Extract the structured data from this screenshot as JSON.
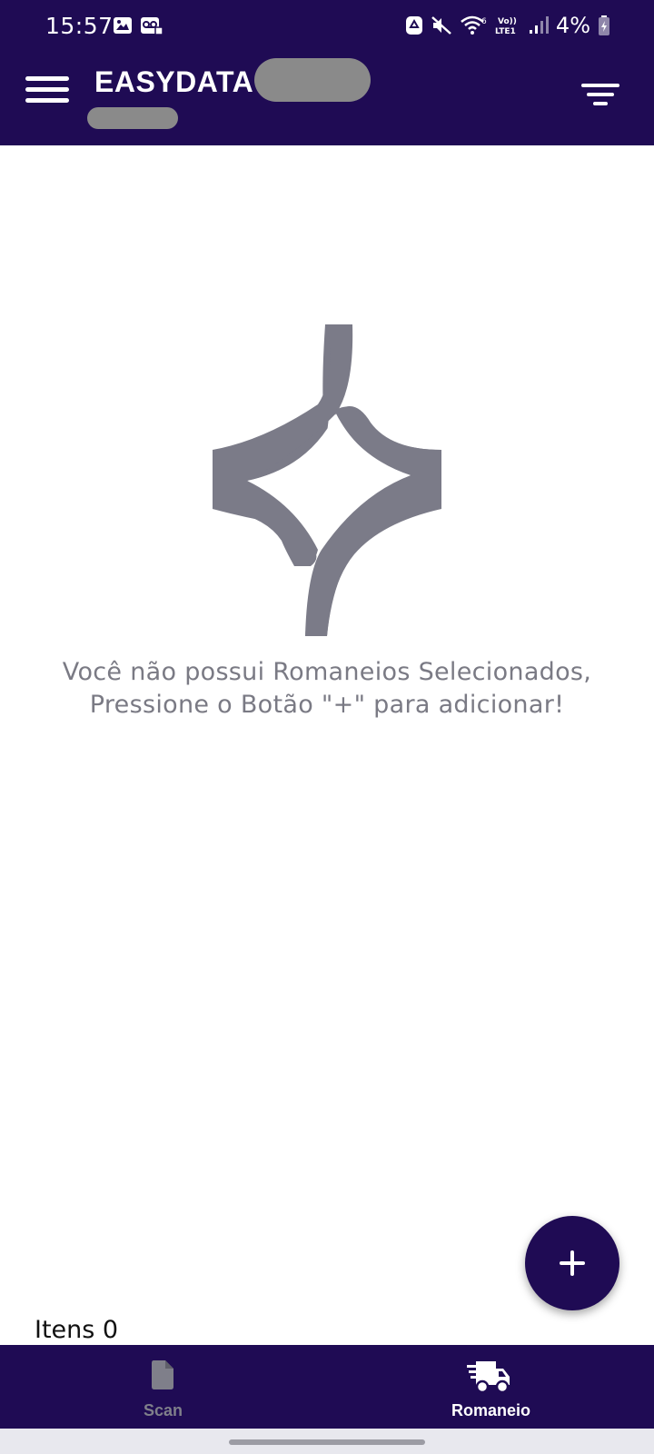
{
  "status_bar": {
    "time": "15:57",
    "battery_text": "4%",
    "left_icons": [
      "gallery-icon",
      "voicemail-icon"
    ],
    "right_icons": [
      "recycle-icon",
      "mute-icon",
      "wifi-icon",
      "volte-icon",
      "signal-icon",
      "battery-icon"
    ],
    "volte_label": "Vo)) LTE1"
  },
  "header": {
    "title": "EASYDATA",
    "menu_icon": "hamburger-menu-icon",
    "filter_icon": "filter-icon",
    "background": "#1f0b54"
  },
  "empty_state": {
    "logo_icon": "easydata-logo-icon",
    "message": "Você não possui Romaneios Selecionados, Pressione o Botão \"+\" para adicionar!"
  },
  "fab": {
    "icon": "plus-icon"
  },
  "footer": {
    "items_label": "Itens 0"
  },
  "bottom_nav": {
    "items": [
      {
        "label": "Scan",
        "icon": "document-icon",
        "active": false
      },
      {
        "label": "Romaneio",
        "icon": "truck-icon",
        "active": true
      }
    ]
  },
  "colors": {
    "primary": "#1f0b54",
    "inactive": "#7f7f8a",
    "message_text": "#7a7a84",
    "logo": "#7b7b88"
  }
}
